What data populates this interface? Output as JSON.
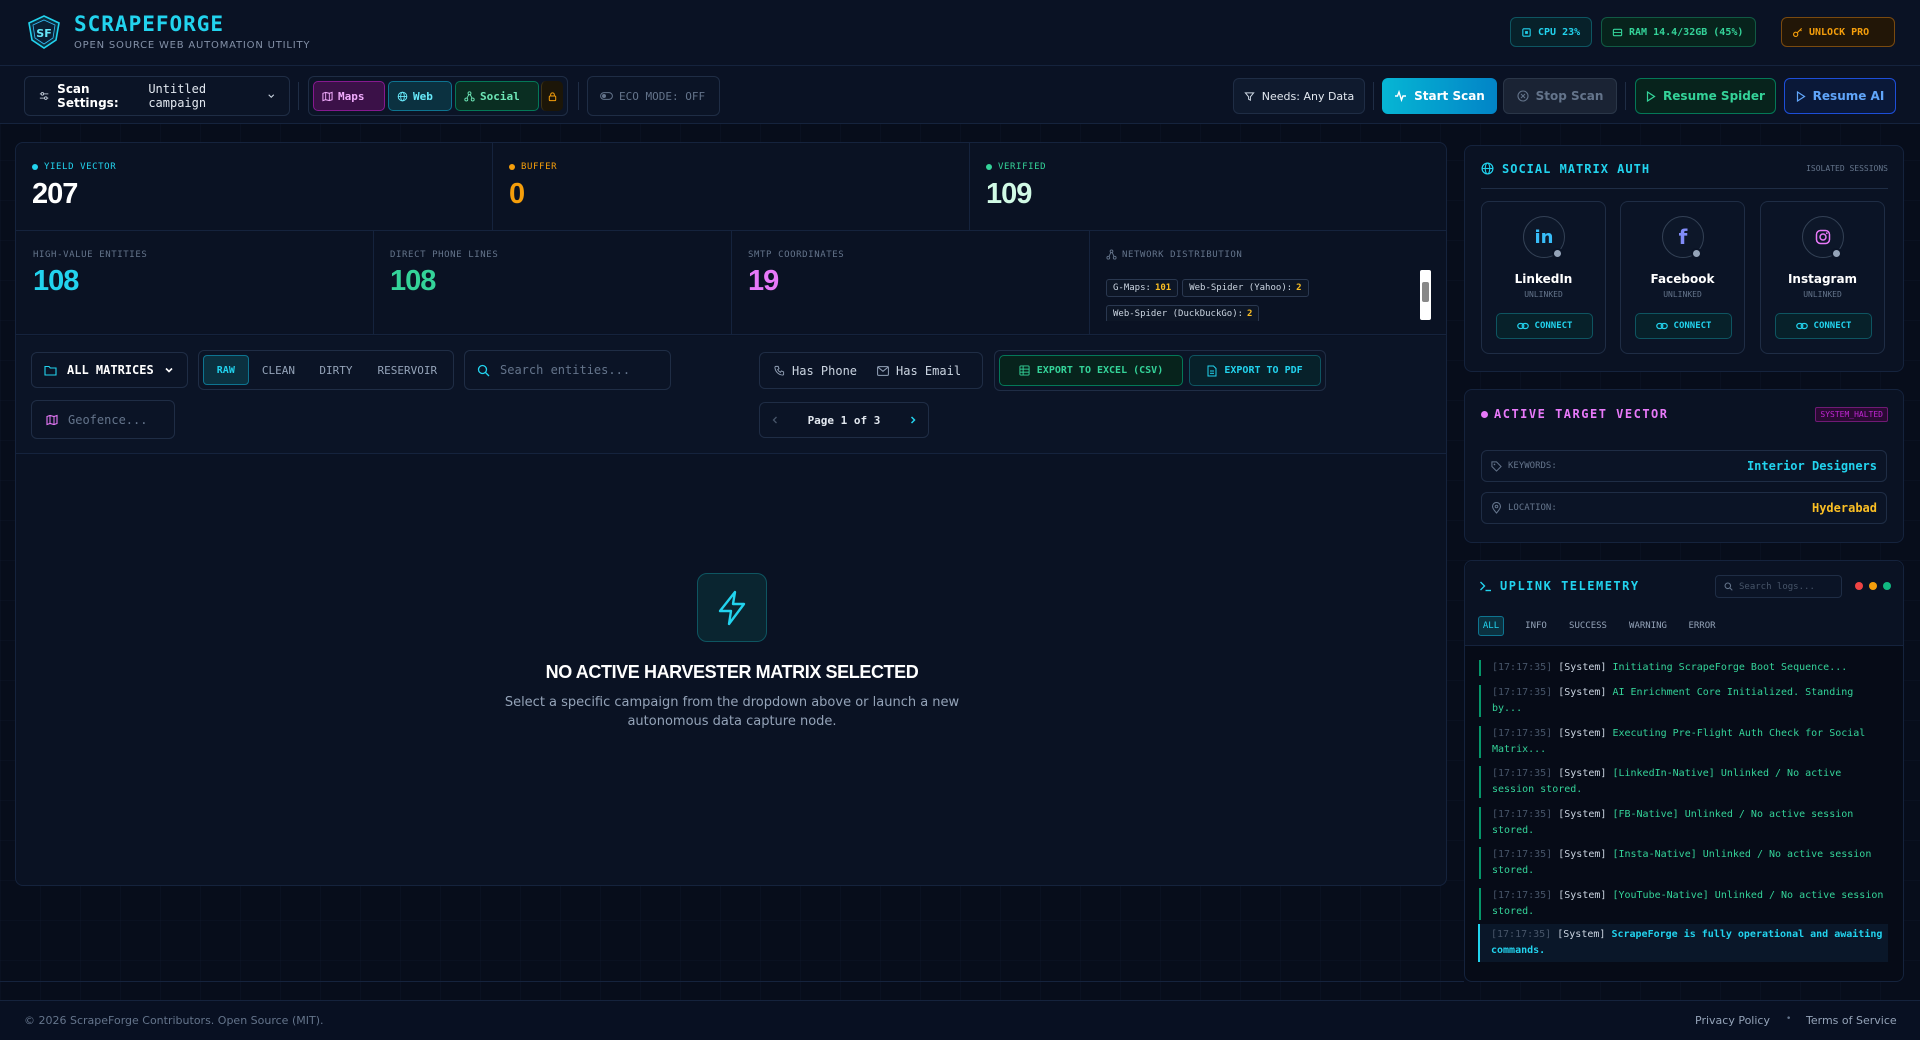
{
  "header": {
    "brand": "SCRAPEFORGE",
    "tagline": "OPEN SOURCE WEB AUTOMATION UTILITY",
    "cpu": "CPU 23%",
    "ram": "RAM 14.4/32GB (45%)",
    "unlock": "UNLOCK PRO"
  },
  "toolbar": {
    "scan_settings_label": "Scan Settings:",
    "campaign": "Untitled campaign",
    "modes": [
      "Maps",
      "Web",
      "Social"
    ],
    "eco": "ECO MODE: OFF",
    "needs": "Needs: Any Data",
    "start": "Start Scan",
    "stop": "Stop Scan",
    "resume_spider": "Resume Spider",
    "resume_ai": "Resume AI"
  },
  "stats": {
    "yield": {
      "label": "YIELD VECTOR",
      "value": "207"
    },
    "buffer": {
      "label": "BUFFER",
      "value": "0"
    },
    "verified": {
      "label": "VERIFIED",
      "value": "109"
    },
    "high_value": {
      "label": "HIGH-VALUE ENTITIES",
      "value": "108"
    },
    "phones": {
      "label": "DIRECT PHONE LINES",
      "value": "108"
    },
    "smtp": {
      "label": "SMTP COORDINATES",
      "value": "19"
    },
    "network": {
      "label": "NETWORK DISTRIBUTION",
      "items": [
        {
          "name": "G-Maps:",
          "count": "101"
        },
        {
          "name": "Web-Spider (Yahoo):",
          "count": "2"
        },
        {
          "name": "Web-Spider (DuckDuckGo):",
          "count": "2"
        }
      ]
    }
  },
  "filters": {
    "matrices": "ALL MATRICES",
    "tabs": [
      "RAW",
      "CLEAN",
      "DIRTY",
      "RESERVOIR"
    ],
    "search_placeholder": "Search entities...",
    "has_phone": "Has Phone",
    "has_email": "Has Email",
    "export_csv": "EXPORT TO EXCEL (CSV)",
    "export_pdf": "EXPORT TO PDF",
    "geofence_placeholder": "Geofence...",
    "page": "Page 1 of 3"
  },
  "empty": {
    "title": "NO ACTIVE HARVESTER MATRIX SELECTED",
    "line1": "Select a specific campaign from the dropdown above or launch a new",
    "line2": "autonomous data capture node."
  },
  "social": {
    "title": "SOCIAL MATRIX AUTH",
    "badge": "ISOLATED SESSIONS",
    "cards": [
      {
        "name": "LinkedIn",
        "status": "UNLINKED",
        "action": "CONNECT",
        "icon": "linkedin-icon"
      },
      {
        "name": "Facebook",
        "status": "UNLINKED",
        "action": "CONNECT",
        "icon": "facebook-icon"
      },
      {
        "name": "Instagram",
        "status": "UNLINKED",
        "action": "CONNECT",
        "icon": "instagram-icon"
      }
    ]
  },
  "target": {
    "title": "ACTIVE TARGET VECTOR",
    "badge": "SYSTEM_HALTED",
    "keywords_label": "KEYWORDS:",
    "keywords": "Interior Designers",
    "location_label": "LOCATION:",
    "location": "Hyderabad"
  },
  "telemetry": {
    "title": "UPLINK TELEMETRY",
    "search_placeholder": "Search logs...",
    "filters": [
      "ALL",
      "INFO",
      "SUCCESS",
      "WARNING",
      "ERROR"
    ],
    "logs": [
      {
        "time": "[17:17:35]",
        "src": "[System]",
        "msg": "Initiating ScrapeForge Boot Sequence..."
      },
      {
        "time": "[17:17:35]",
        "src": "[System]",
        "msg": "AI Enrichment Core Initialized. Standing by..."
      },
      {
        "time": "[17:17:35]",
        "src": "[System]",
        "msg": "Executing Pre-Flight Auth Check for Social Matrix..."
      },
      {
        "time": "[17:17:35]",
        "src": "[System]",
        "msg": "[LinkedIn-Native] Unlinked / No active session stored."
      },
      {
        "time": "[17:17:35]",
        "src": "[System]",
        "msg": "[FB-Native] Unlinked / No active session stored."
      },
      {
        "time": "[17:17:35]",
        "src": "[System]",
        "msg": "[Insta-Native] Unlinked / No active session stored."
      },
      {
        "time": "[17:17:35]",
        "src": "[System]",
        "msg": "[YouTube-Native] Unlinked / No active session stored."
      },
      {
        "time": "[17:17:35]",
        "src": "[System]",
        "msg": "ScrapeForge is fully operational and awaiting commands."
      }
    ]
  },
  "footer": {
    "copyright": "© 2026 ScrapeForge Contributors. Open Source (MIT).",
    "privacy": "Privacy Policy",
    "sep": "•",
    "terms": "Terms of Service"
  },
  "colors": {
    "accent": "#22d3ee",
    "success": "#34d399",
    "warning": "#f59e0b",
    "magenta": "#d946ef"
  }
}
